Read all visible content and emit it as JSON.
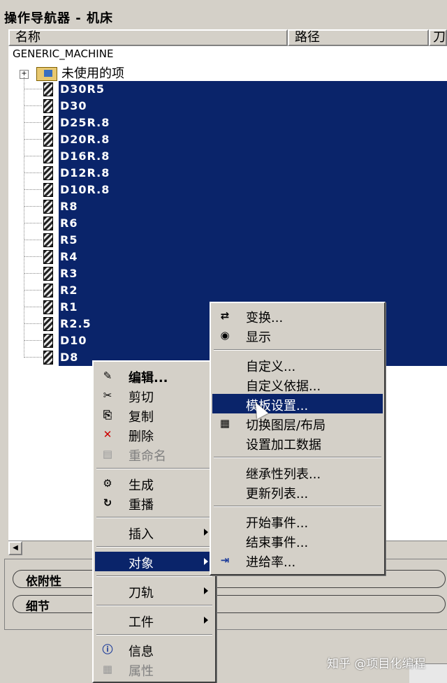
{
  "window": {
    "title": "操作导航器 - 机床"
  },
  "columns": {
    "name": "名称",
    "path": "路径",
    "extra": "刀"
  },
  "tree": {
    "root": "GENERIC_MACHINE",
    "expander": "+",
    "unused_label": "未使用的项",
    "tools": [
      "D30R5",
      "D30",
      "D25R.8",
      "D20R.8",
      "D16R.8",
      "D12R.8",
      "D10R.8",
      "R8",
      "R6",
      "R5",
      "R4",
      "R3",
      "R2",
      "R1",
      "R2.5",
      "D10",
      "D8"
    ]
  },
  "panels": {
    "dependencies": "依附性",
    "details": "细节"
  },
  "context_menu": {
    "edit": "编辑...",
    "cut": "剪切",
    "copy": "复制",
    "delete": "删除",
    "rename": "重命名",
    "generate": "生成",
    "replay": "重播",
    "insert": "插入",
    "object": "对象",
    "toolpath": "刀轨",
    "workpiece": "工件",
    "info": "信息",
    "properties": "属性"
  },
  "submenu": {
    "transform": "变换...",
    "display": "显示",
    "customize": "自定义...",
    "customize_basis": "自定义依据...",
    "template_setup": "模板设置...",
    "switch_layer": "切换图层/布局",
    "set_machining_data": "设置加工数据",
    "inheritance_list": "继承性列表...",
    "update_list": "更新列表...",
    "start_event": "开始事件...",
    "end_event": "结束事件...",
    "feed_rate": "进给率..."
  },
  "watermark": "知乎 @项目化编程",
  "colors": {
    "selection": "#0a246a",
    "face": "#d4d0c8"
  }
}
